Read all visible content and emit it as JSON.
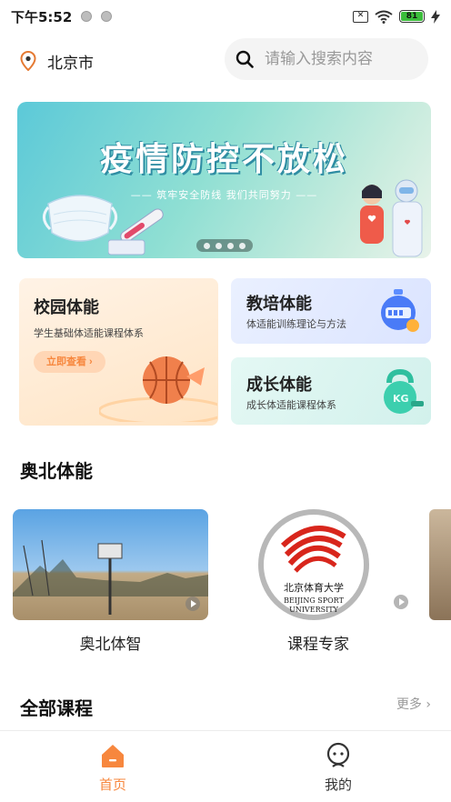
{
  "status_bar": {
    "time": "下午5:52",
    "battery": "81"
  },
  "header": {
    "location": "北京市",
    "search_placeholder": "请输入搜索内容"
  },
  "banner": {
    "title": "疫情防控不放松",
    "subtitle": "—— 筑牢安全防线  我们共同努力 ——",
    "dot_count": 4
  },
  "features": {
    "campus": {
      "title": "校园体能",
      "desc": "学生基础体适能课程体系",
      "button": "立即查看 ›"
    },
    "training": {
      "title": "教培体能",
      "desc": "体适能训练理论与方法"
    },
    "growth": {
      "title": "成长体能",
      "desc": "成长体适能课程体系"
    }
  },
  "aobei": {
    "title": "奥北体能",
    "items": [
      {
        "label": "奥北体智"
      },
      {
        "label": "课程专家",
        "logo_text": "北京体育大学",
        "logo_en1": "BEIJING SPORT",
        "logo_en2": "UNIVERSITY"
      }
    ]
  },
  "all_courses": {
    "title": "全部课程",
    "more": "更多 ›"
  },
  "tabs": [
    {
      "label": "首页",
      "active": true
    },
    {
      "label": "我的",
      "active": false
    }
  ],
  "colors": {
    "accent": "#f7873e",
    "campus_card": "#ffe4c4",
    "training_card": "#dbe4ff",
    "growth_card": "#d2f1ec"
  }
}
